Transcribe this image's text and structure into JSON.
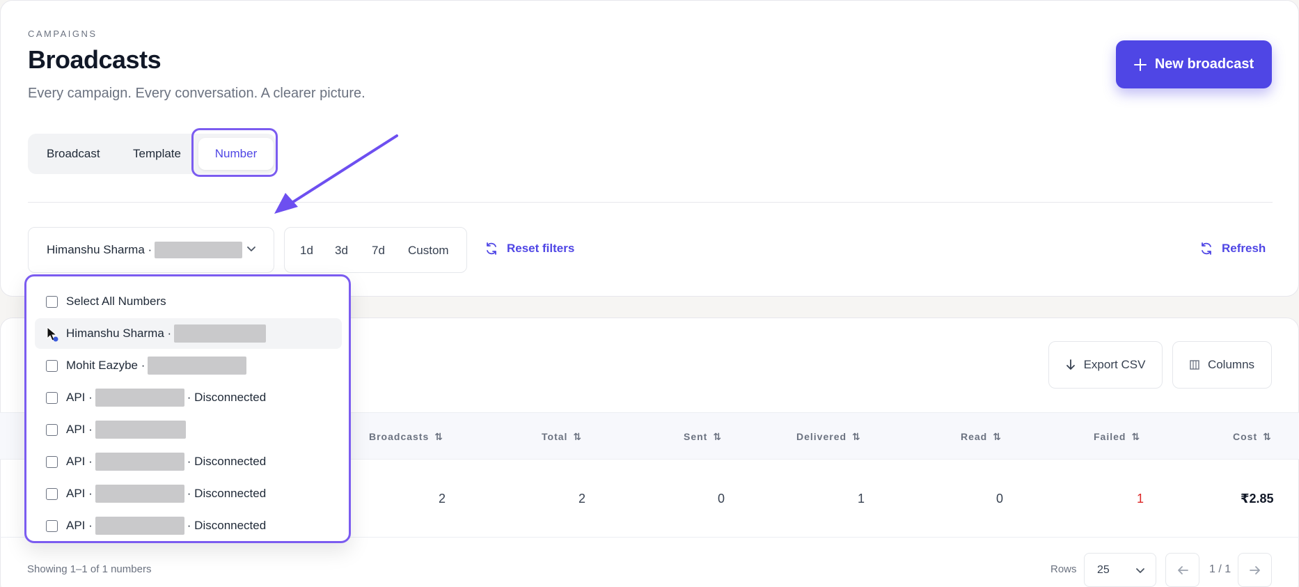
{
  "header": {
    "eyebrow": "CAMPAIGNS",
    "title": "Broadcasts",
    "subtitle": "Every campaign. Every conversation. A clearer picture.",
    "new_button_icon": "plus-icon",
    "new_button_label": "New broadcast"
  },
  "tabs": {
    "items": [
      {
        "label": "Broadcast"
      },
      {
        "label": "Template"
      },
      {
        "label": "Number"
      }
    ],
    "active": "Number"
  },
  "filters": {
    "number_select_value": "Himanshu Sharma ·",
    "ranges": [
      "1d",
      "3d",
      "7d",
      "Custom"
    ],
    "reset_label": "Reset filters",
    "refresh_label": "Refresh"
  },
  "dropdown": {
    "select_all_label": "Select All Numbers",
    "options": [
      {
        "prefix": "Himanshu Sharma ·",
        "suffix": "",
        "hovered": true
      },
      {
        "prefix": "Mohit Eazybe ·",
        "suffix": ""
      },
      {
        "prefix": "API ·",
        "suffix": "· Disconnected"
      },
      {
        "prefix": "API ·",
        "suffix": ""
      },
      {
        "prefix": "API ·",
        "suffix": "· Disconnected"
      },
      {
        "prefix": "API ·",
        "suffix": "· Disconnected"
      },
      {
        "prefix": "API ·",
        "suffix": "· Disconnected"
      }
    ]
  },
  "toolbar": {
    "export_label": "Export CSV",
    "columns_label": "Columns"
  },
  "table": {
    "headers": [
      "Broadcasts",
      "Total",
      "Sent",
      "Delivered",
      "Read",
      "Failed",
      "Cost"
    ],
    "row": {
      "broadcasts": "2",
      "total": "2",
      "sent": "0",
      "delivered": "1",
      "read": "0",
      "failed": "1",
      "cost": "₹2.85"
    }
  },
  "footer": {
    "showing": "Showing 1–1 of 1 numbers",
    "rows_label": "Rows",
    "rows_value": "25",
    "page": "1 / 1"
  },
  "colors": {
    "accent": "#4f46e5",
    "highlight": "#7b5cf0",
    "failed": "#dc2626"
  }
}
